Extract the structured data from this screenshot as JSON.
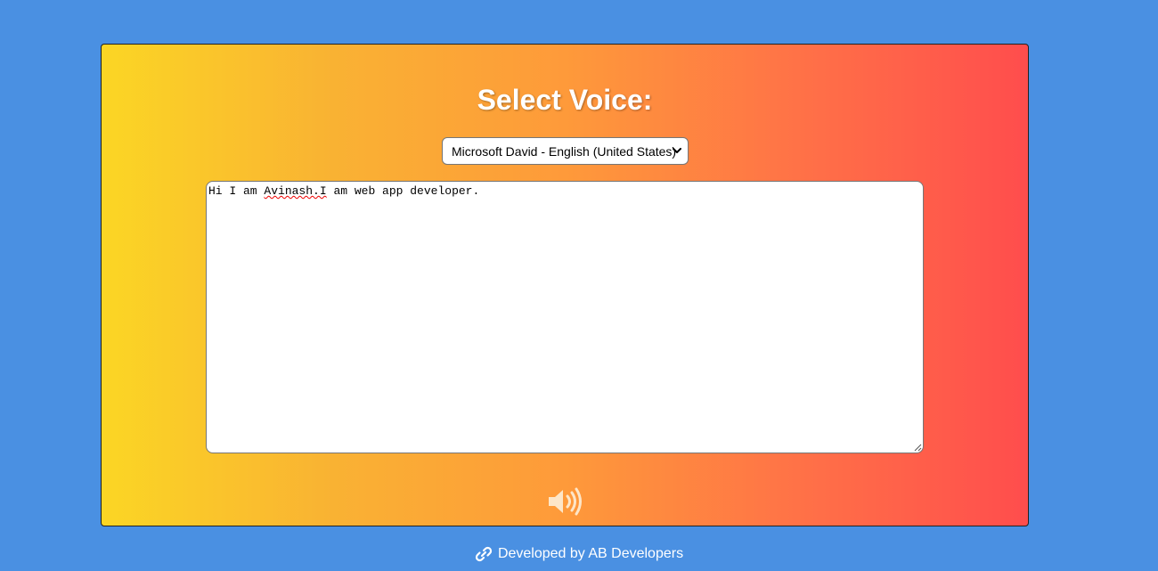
{
  "app": {
    "title": "Select Voice:"
  },
  "voice_select": {
    "selected": "Microsoft David - English (United States)"
  },
  "textarea": {
    "prefix": "Hi I am ",
    "misspelled": "Avinash.I",
    "suffix": " am web app developer."
  },
  "speak_button": {
    "icon": "volume-icon"
  },
  "footer": {
    "text": "Developed by AB Developers",
    "icon": "link-icon"
  },
  "colors": {
    "page_background": "#4a90e2",
    "gradient_start": "#fbd624",
    "gradient_end": "#ff4d4d",
    "title_text": "#ffffff"
  }
}
